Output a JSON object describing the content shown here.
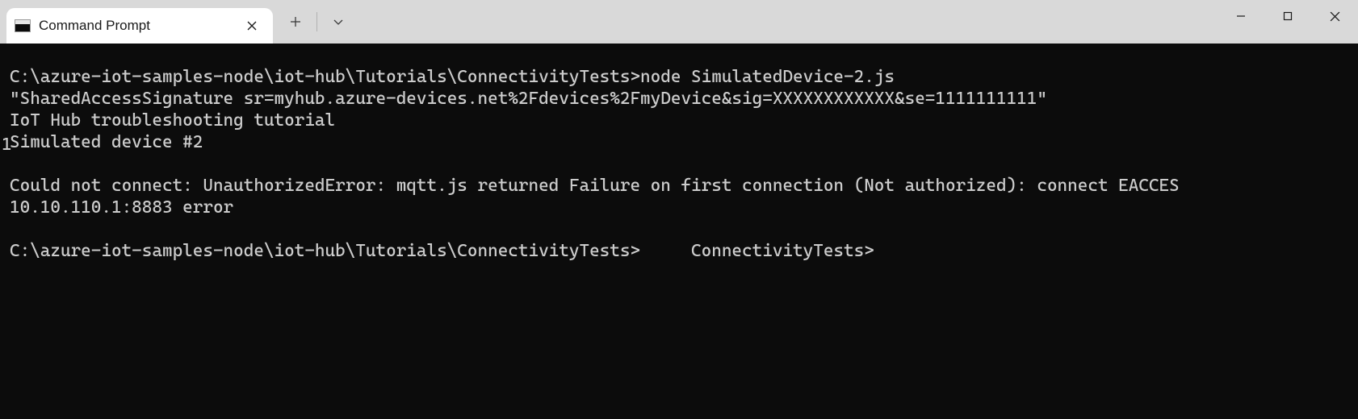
{
  "titlebar": {
    "tab_title": "Command Prompt",
    "tab_icon": "cmd-icon",
    "close_tab_glyph": "✕",
    "new_tab_glyph": "＋",
    "dropdown_glyph": "⌄"
  },
  "window_controls": {
    "minimize": "—",
    "maximize": "▢",
    "close": "✕"
  },
  "gutter": {
    "marker": "1"
  },
  "terminal": {
    "lines": [
      "C:\\azure-iot-samples-node\\iot-hub\\Tutorials\\ConnectivityTests>node SimulatedDevice-2.js",
      "\"SharedAccessSignature sr=myhub.azure-devices.net%2Fdevices%2FmyDevice&sig=XXXXXXXXXXXX&se=1111111111\"",
      "IoT Hub troubleshooting tutorial",
      "Simulated device #2",
      "",
      "Could not connect: UnauthorizedError: mqtt.js returned Failure on first connection (Not authorized): connect EACCES",
      "10.10.110.1:8883 error",
      "",
      "C:\\azure-iot-samples-node\\iot-hub\\Tutorials\\ConnectivityTests>     ConnectivityTests>"
    ]
  }
}
